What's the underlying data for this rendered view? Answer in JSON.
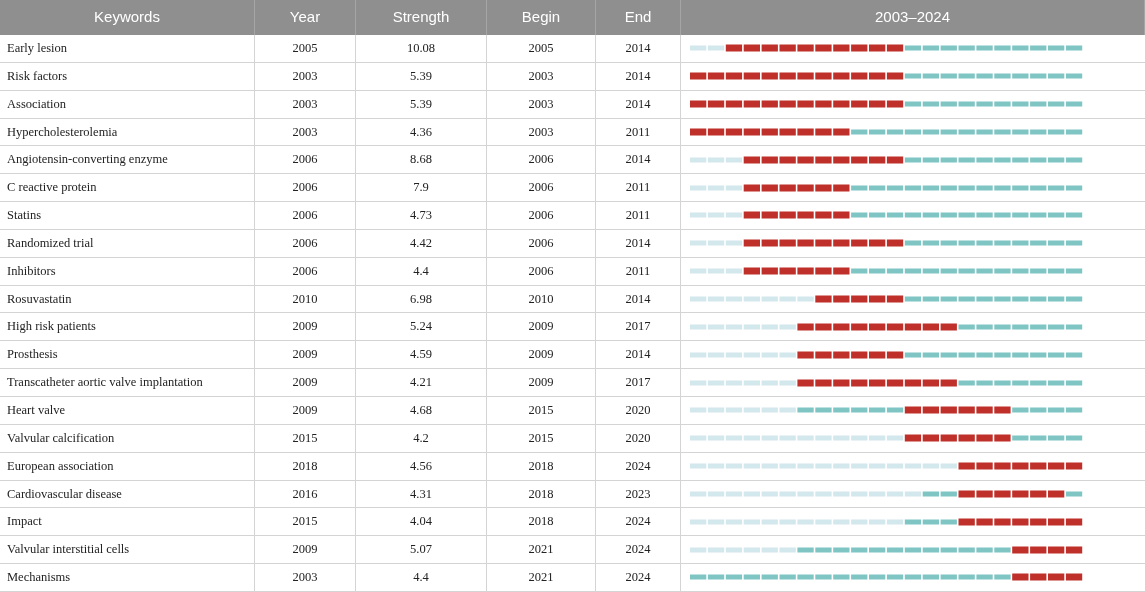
{
  "table": {
    "columns": [
      "Keywords",
      "Year",
      "Strength",
      "Begin",
      "End",
      "2003–2024"
    ],
    "rows": [
      {
        "keyword": "Early lesion",
        "year": "2005",
        "strength": "10.08",
        "begin": "2005",
        "end": "2014"
      },
      {
        "keyword": "Risk factors",
        "year": "2003",
        "strength": "5.39",
        "begin": "2003",
        "end": "2014"
      },
      {
        "keyword": "Association",
        "year": "2003",
        "strength": "5.39",
        "begin": "2003",
        "end": "2014"
      },
      {
        "keyword": "Hypercholesterolemia",
        "year": "2003",
        "strength": "4.36",
        "begin": "2003",
        "end": "2011"
      },
      {
        "keyword": "Angiotensin-converting enzyme",
        "year": "2006",
        "strength": "8.68",
        "begin": "2006",
        "end": "2014"
      },
      {
        "keyword": "C reactive protein",
        "year": "2006",
        "strength": "7.9",
        "begin": "2006",
        "end": "2011"
      },
      {
        "keyword": "Statins",
        "year": "2006",
        "strength": "4.73",
        "begin": "2006",
        "end": "2011"
      },
      {
        "keyword": "Randomized trial",
        "year": "2006",
        "strength": "4.42",
        "begin": "2006",
        "end": "2014"
      },
      {
        "keyword": "Inhibitors",
        "year": "2006",
        "strength": "4.4",
        "begin": "2006",
        "end": "2011"
      },
      {
        "keyword": "Rosuvastatin",
        "year": "2010",
        "strength": "6.98",
        "begin": "2010",
        "end": "2014"
      },
      {
        "keyword": "High risk patients",
        "year": "2009",
        "strength": "5.24",
        "begin": "2009",
        "end": "2017"
      },
      {
        "keyword": "Prosthesis",
        "year": "2009",
        "strength": "4.59",
        "begin": "2009",
        "end": "2014"
      },
      {
        "keyword": "Transcatheter aortic valve implantation",
        "year": "2009",
        "strength": "4.21",
        "begin": "2009",
        "end": "2017"
      },
      {
        "keyword": "Heart valve",
        "year": "2009",
        "strength": "4.68",
        "begin": "2015",
        "end": "2020"
      },
      {
        "keyword": "Valvular calcification",
        "year": "2015",
        "strength": "4.2",
        "begin": "2015",
        "end": "2020"
      },
      {
        "keyword": "European association",
        "year": "2018",
        "strength": "4.56",
        "begin": "2018",
        "end": "2024"
      },
      {
        "keyword": "Cardiovascular disease",
        "year": "2016",
        "strength": "4.31",
        "begin": "2018",
        "end": "2023"
      },
      {
        "keyword": "Impact",
        "year": "2015",
        "strength": "4.04",
        "begin": "2018",
        "end": "2024"
      },
      {
        "keyword": "Valvular interstitial cells",
        "year": "2009",
        "strength": "5.07",
        "begin": "2021",
        "end": "2024"
      },
      {
        "keyword": "Mechanisms",
        "year": "2003",
        "strength": "4.4",
        "begin": "2021",
        "end": "2024"
      }
    ]
  }
}
